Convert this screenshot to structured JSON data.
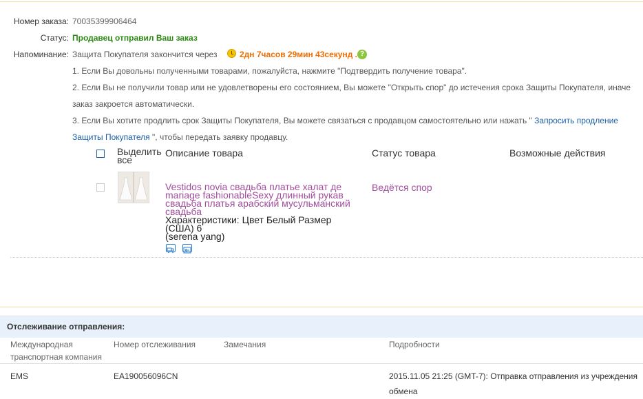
{
  "order": {
    "number_label": "Номер заказа:",
    "number_value": "70035399906464",
    "status_label": "Статус:",
    "status_value": "Продавец отправил Ваш заказ",
    "reminder_label": "Напоминание:",
    "reminder_prefix": "Защита Покупателя закончится через",
    "reminder_timer": "2дн 7часов 29мин 43секунд .",
    "reminder_help": "?",
    "note1": "1. Если Вы довольны полученными товарами, пожалуйста, нажмите \"Подтвердить получение товара\".",
    "note2_line1": "2. Если Вы не получили товар или не удовлетворены его состоянием, Вы можете \"Открыть спор\" до истечения срока Защиты Покупателя, иначе",
    "note2_line2": "заказ закроется автоматически.",
    "note3_text": "3. Если Вы хотите продлить срок Защиты Покупателя, Вы можете связаться с продавцом самостоятельно или нажать \"",
    "note3_link_part1": "Запросить продление",
    "note3_link_part2": "Защиты Покупателя",
    "note3_suffix": "\", чтобы передать заявку продавцу."
  },
  "products_table": {
    "headers": {
      "select_all": "Выделить все",
      "description": "Описание товара",
      "status": "Статус товара",
      "actions": "Возможные действия"
    },
    "rows": [
      {
        "title": "Vestidos novia свадьба платье халат де mariage fashionableSexy длинный рукав свадьба платья арабский мусульманский свадьба",
        "specs": "Характеристики: Цвет Белый Размер (США) 6",
        "seller": "(serena yang)",
        "status": "Ведётся спор",
        "icons": [
          "shipping-icon",
          "logistics-icon"
        ]
      }
    ]
  },
  "tracking": {
    "title": "Отслеживание отправления:",
    "headers": {
      "company": "Международная транспортная компания",
      "tracking_number": "Номер отслеживания",
      "remarks": "Замечания",
      "details": "Подробности"
    },
    "rows": [
      {
        "company": "EMS",
        "tracking_number": "EA190056096CN",
        "remarks": "",
        "details": "2015.11.05 21:25 (GMT-7): Отправка отправления из учреждения обмена"
      }
    ]
  },
  "colors": {
    "status_green": "#2b8a12",
    "timer_orange": "#f06b00",
    "link_blue": "#1b5fa8",
    "product_purple": "#a14e9c",
    "tracking_bg": "#e8f1fb"
  }
}
